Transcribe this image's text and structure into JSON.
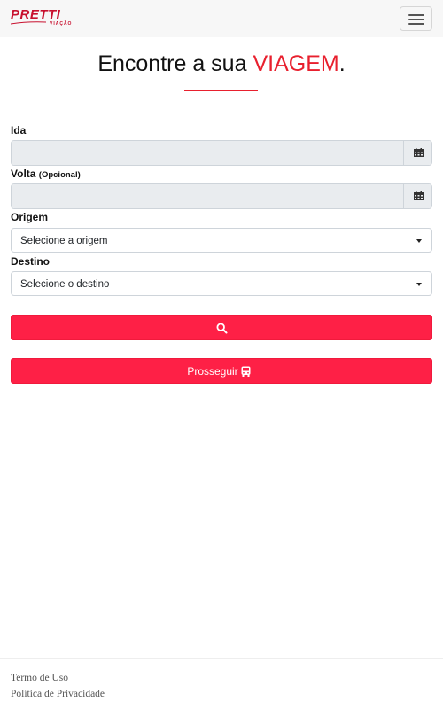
{
  "navbar": {
    "logo_text": "PRETTI",
    "logo_subtext": "VIAÇÃO",
    "menu_icon": "hamburger-icon"
  },
  "heading": {
    "prefix": "Encontre a sua ",
    "highlight": "VIAGEM",
    "suffix": "."
  },
  "form": {
    "ida": {
      "label": "Ida",
      "value": "",
      "icon": "calendar-icon"
    },
    "volta": {
      "label": "Volta",
      "optional": "(Opcional)",
      "value": "",
      "icon": "calendar-icon"
    },
    "origem": {
      "label": "Origem",
      "selected": "Selecione a origem"
    },
    "destino": {
      "label": "Destino",
      "selected": "Selecione o destino"
    },
    "search_icon": "search-icon",
    "proceed_label": "Prosseguir",
    "proceed_icon": "bus-icon"
  },
  "footer": {
    "terms": "Termo de Uso",
    "privacy": "Política de Privacidade"
  },
  "colors": {
    "accent": "#e8202e",
    "button": "#fe2046",
    "input_disabled_bg": "#e9ecef"
  }
}
